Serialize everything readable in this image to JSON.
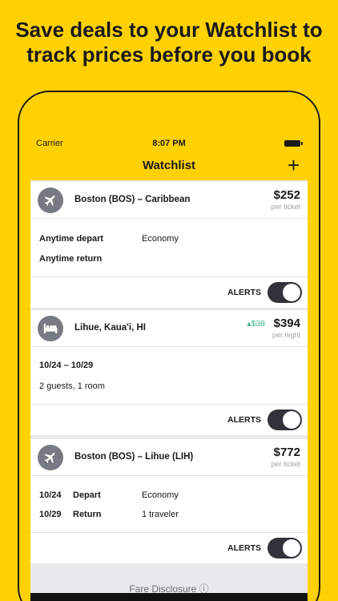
{
  "headline": {
    "line1": "Save deals to your Watchlist to",
    "line2": "track prices before you book"
  },
  "status_bar": {
    "carrier": "Carrier",
    "time": "8:07 PM"
  },
  "nav": {
    "title": "Watchlist",
    "add_label": "+"
  },
  "cards": [
    {
      "type": "flight",
      "icon": "airplane-icon",
      "place": "Boston (BOS) – Caribbean",
      "price": "$252",
      "price_unit": "per ticket",
      "depart": "Anytime depart",
      "cabin": "Economy",
      "return": "Anytime return",
      "alerts_label": "ALERTS",
      "alerts_on": true
    },
    {
      "type": "hotel",
      "icon": "bed-icon",
      "place": "Lihue, Kaua'i, HI",
      "delta": "▴$38",
      "price": "$394",
      "price_unit": "per night",
      "dates": "10/24 – 10/29",
      "guests": "2 guests, 1 room",
      "alerts_label": "ALERTS",
      "alerts_on": true
    },
    {
      "type": "flight",
      "icon": "airplane-icon",
      "place": "Boston (BOS) – Lihue (LIH)",
      "price": "$772",
      "price_unit": "per ticket",
      "depart_date": "10/24",
      "depart_label": "Depart",
      "cabin": "Economy",
      "return_date": "10/29",
      "return_label": "Return",
      "travelers": "1 traveler",
      "alerts_label": "ALERTS",
      "alerts_on": true
    }
  ],
  "footer": {
    "disclosure": "Fare Disclosure ⓘ"
  },
  "colors": {
    "brand_yellow": "#FFD100",
    "icon_gray": "#777a82",
    "toggle_dark": "#31323a",
    "price_up_green": "#3db98a"
  }
}
